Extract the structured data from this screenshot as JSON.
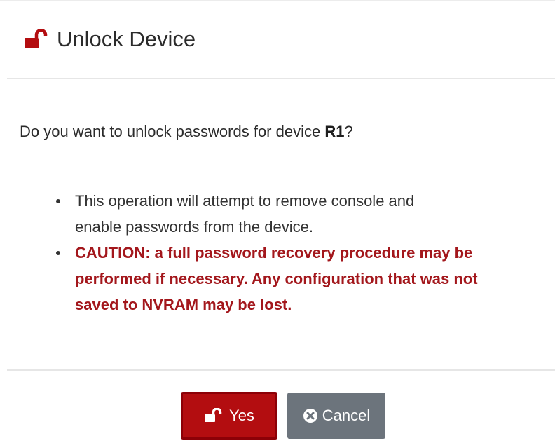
{
  "dialog": {
    "title": "Unlock Device",
    "title_icon": "unlock-icon",
    "question_prefix": "Do you want to unlock passwords for device ",
    "device_name": "R1",
    "question_suffix": "?",
    "notes": [
      "This operation will attempt to remove console and",
      "enable passwords from the device."
    ],
    "caution": [
      "CAUTION: a full password recovery procedure may be",
      "performed if necessary. Any configuration that was not",
      "saved to NVRAM may be lost."
    ]
  },
  "buttons": {
    "yes_label": "Yes",
    "yes_icon": "unlock-icon",
    "cancel_label": "Cancel",
    "cancel_icon": "close-circle-icon"
  },
  "colors": {
    "accent": "#b30d10",
    "caution_text": "#a3171c",
    "cancel_button": "#6c747c"
  }
}
